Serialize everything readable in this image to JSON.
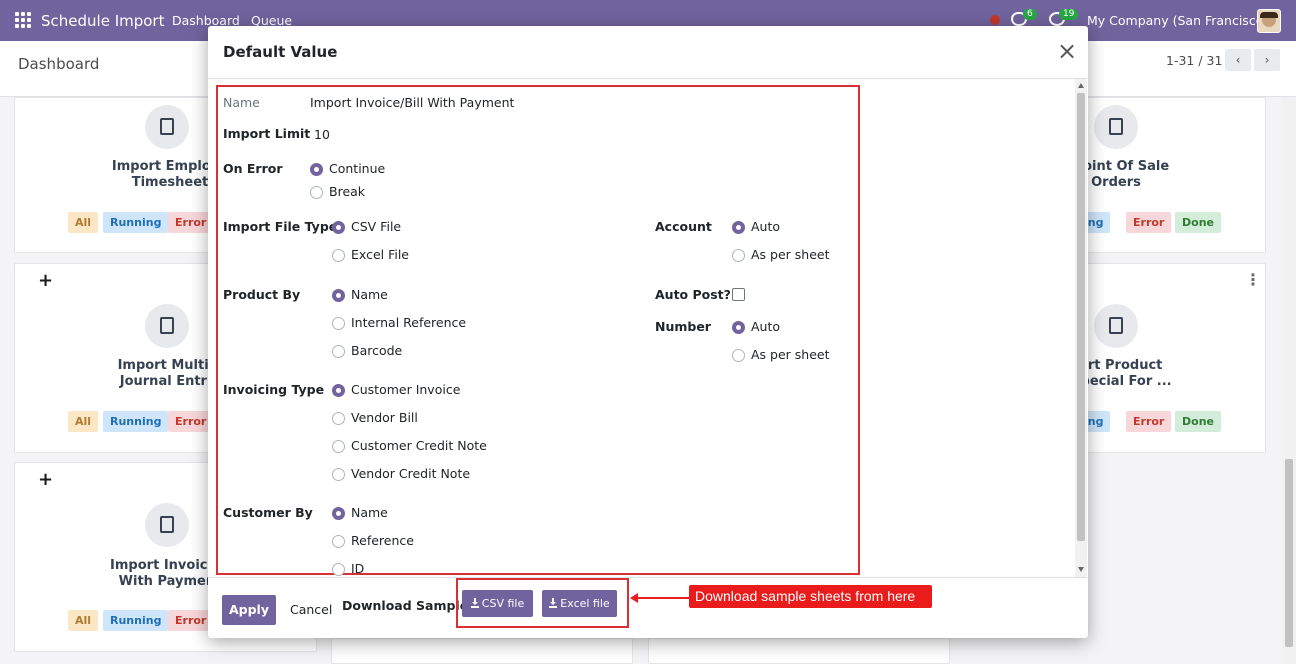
{
  "navbar": {
    "app_name": "Schedule Import",
    "menu": [
      "Dashboard",
      "Queue"
    ],
    "messages_count": "6",
    "activities_count": "19",
    "company": "My Company (San Francisco)"
  },
  "control_panel": {
    "title": "Dashboard",
    "pager": "1-31 / 31"
  },
  "kanban": {
    "cards": [
      {
        "title_line1": "Import Employe",
        "title_line2": "Timesheet",
        "tags": [
          "All",
          "Running",
          "Error"
        ]
      },
      {
        "title_line1": "t Point Of Sale",
        "title_line2": "Orders",
        "tags": [
          "ing",
          "Error",
          "Done"
        ]
      },
      {
        "title_line1": "Import Multipl",
        "title_line2": "Journal Entrie",
        "tags": [
          "All",
          "Running",
          "Error"
        ]
      },
      {
        "title_line1": "port Product",
        "title_line2": "t Special For ...",
        "tags": [
          "ing",
          "Error",
          "Done"
        ]
      },
      {
        "title_line1": "Import Invoice/E",
        "title_line2": "With Payment",
        "tags": [
          "All",
          "Running",
          "Error"
        ]
      }
    ],
    "plus": "+"
  },
  "dialog": {
    "title": "Default Value",
    "close": "×",
    "fields": {
      "name_label": "Name",
      "name_value": "Import Invoice/Bill With Payment",
      "import_limit_label": "Import Limit",
      "import_limit_value": "10",
      "on_error_label": "On Error",
      "on_error_options": [
        "Continue",
        "Break"
      ],
      "file_type_label": "Import File Type",
      "file_type_options": [
        "CSV File",
        "Excel File"
      ],
      "product_by_label": "Product By",
      "product_by_options": [
        "Name",
        "Internal Reference",
        "Barcode"
      ],
      "invoicing_type_label": "Invoicing Type",
      "invoicing_type_options": [
        "Customer Invoice",
        "Vendor Bill",
        "Customer Credit Note",
        "Vendor Credit Note"
      ],
      "customer_by_label": "Customer By",
      "customer_by_options": [
        "Name",
        "Reference",
        "ID"
      ],
      "account_label": "Account",
      "account_options": [
        "Auto",
        "As per sheet"
      ],
      "auto_post_label": "Auto Post?",
      "auto_post_checked": false,
      "number_label": "Number",
      "number_options": [
        "Auto",
        "As per sheet"
      ]
    },
    "footer": {
      "apply": "Apply",
      "cancel": "Cancel",
      "download_label": "Download Sample:",
      "csv_button": "CSV file",
      "excel_button": "Excel file"
    }
  },
  "annotation": {
    "callout": "Download sample sheets from here"
  },
  "colors": {
    "brand": "#71639e",
    "annotation_red": "#e91b1b"
  }
}
